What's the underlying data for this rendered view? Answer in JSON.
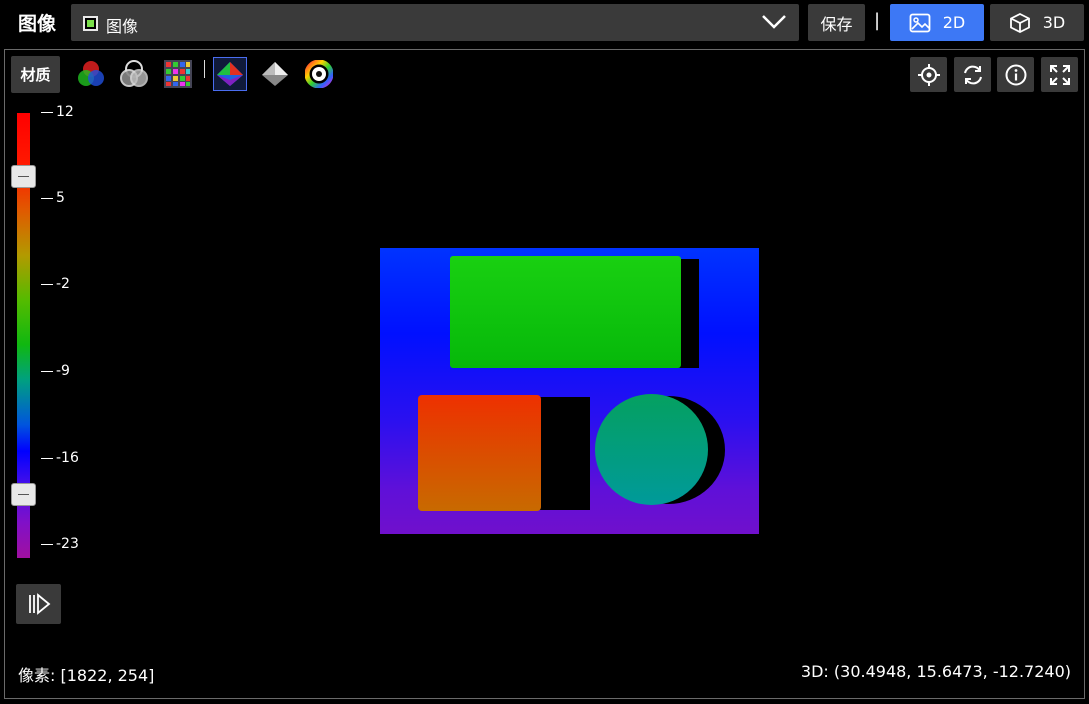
{
  "header": {
    "title": "图像",
    "source_label": "图像",
    "save_label": "保存",
    "divider": "|",
    "mode_2d_label": "2D",
    "mode_3d_label": "3D",
    "active_mode": "2D",
    "accent_color": "#3d78f5"
  },
  "toolbar": {
    "material_label": "材质",
    "tools": [
      {
        "name": "rgb-channels-icon"
      },
      {
        "name": "grayscale-channels-icon"
      },
      {
        "name": "color-grid-icon"
      },
      {
        "name": "color-depth-shading-icon",
        "active": true
      },
      {
        "name": "gray-shading-icon"
      },
      {
        "name": "color-wheel-icon"
      }
    ],
    "right_tools": [
      {
        "name": "locate-icon"
      },
      {
        "name": "refresh-icon"
      },
      {
        "name": "info-icon"
      },
      {
        "name": "fullscreen-icon"
      }
    ]
  },
  "colorbar": {
    "ticks": [
      "12",
      "5",
      "-2",
      "-9",
      "-16",
      "-23"
    ],
    "upper_handle_value": 6,
    "lower_handle_value": -20
  },
  "status": {
    "pixel": "像素: [1822, 254]",
    "coord_3d": "3D: (30.4948, 15.6473, -12.7240)"
  }
}
